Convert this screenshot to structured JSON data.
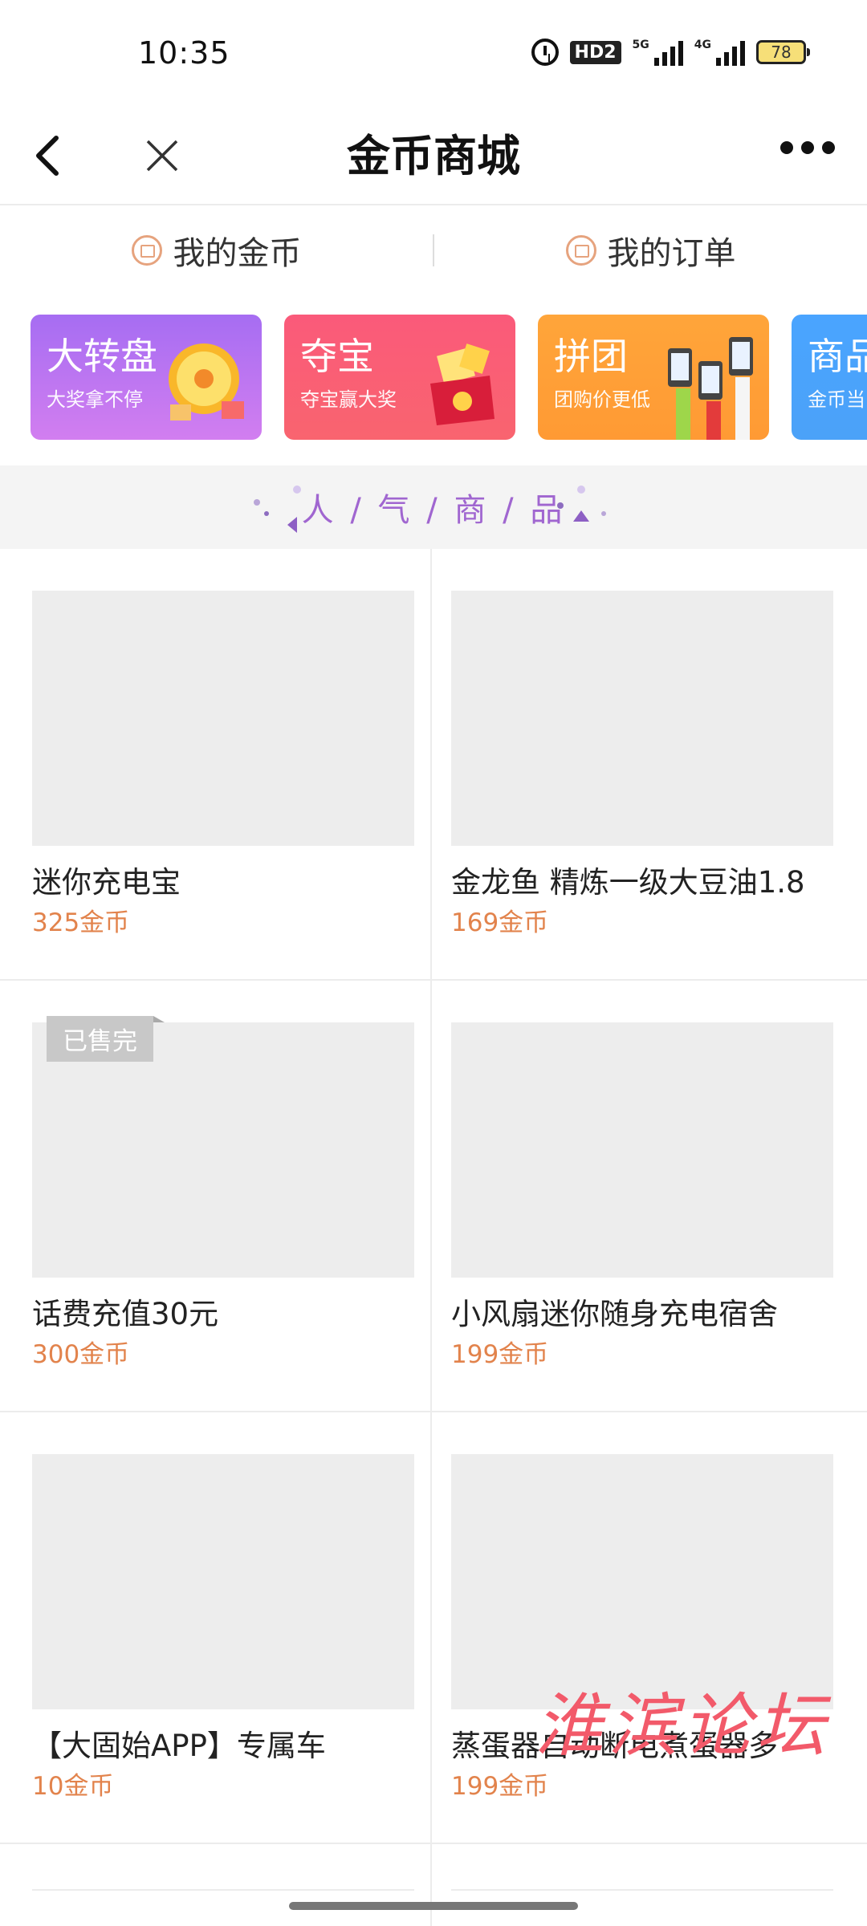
{
  "status_bar": {
    "time": "10:35",
    "hd_label": "HD2",
    "net1": "5G",
    "net2": "4G",
    "battery": "78"
  },
  "navbar": {
    "title": "金币商城",
    "icons": [
      "back-arrow-icon",
      "close-icon",
      "more-icon"
    ]
  },
  "tabs": [
    {
      "label": "我的金币",
      "icon": "coin-wallet-icon"
    },
    {
      "label": "我的订单",
      "icon": "order-list-icon"
    }
  ],
  "banners": [
    {
      "title": "大转盘",
      "subtitle": "大奖拿不停",
      "color": "#b06ef2"
    },
    {
      "title": "夺宝",
      "subtitle": "夺宝赢大奖",
      "color": "#fa5a78"
    },
    {
      "title": "拼团",
      "subtitle": "团购价更低",
      "color": "#ffa03a"
    },
    {
      "title": "商品",
      "subtitle": "金币当",
      "color": "#4aa4ff"
    }
  ],
  "section": {
    "title": "人 / 气 / 商 / 品"
  },
  "products": [
    {
      "name": "迷你充电宝",
      "price": "325金币"
    },
    {
      "name": "金龙鱼 精炼一级大豆油1.8",
      "price": "169金币"
    },
    {
      "name": "话费充值30元",
      "price": "300金币",
      "badge": "已售完"
    },
    {
      "name": "小风扇迷你随身充电宿舍",
      "price": "199金币"
    },
    {
      "name": "【大固始APP】专属车",
      "price": "10金币"
    },
    {
      "name": "蒸蛋器自动断电煮蛋器多",
      "price": "199金币"
    }
  ],
  "watermark": "淮滨论坛",
  "accent_color": "#e2834c"
}
